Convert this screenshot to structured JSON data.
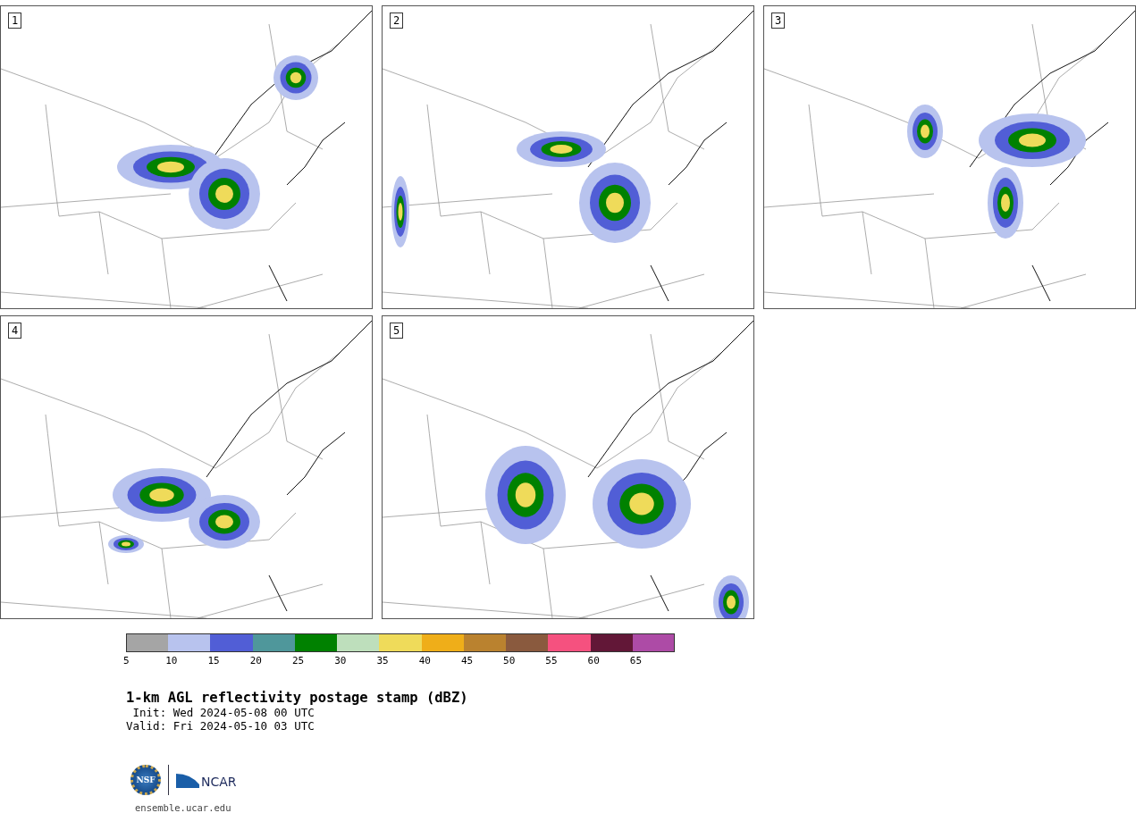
{
  "panels": [
    {
      "label": "1"
    },
    {
      "label": "2"
    },
    {
      "label": "3"
    },
    {
      "label": "4"
    },
    {
      "label": "5"
    }
  ],
  "colorbar": [
    {
      "label": "5",
      "color": "#a5a5a5"
    },
    {
      "label": "10",
      "color": "#b8c3ee"
    },
    {
      "label": "15",
      "color": "#515ed6"
    },
    {
      "label": "20",
      "color": "#4f979b"
    },
    {
      "label": "25",
      "color": "#008100"
    },
    {
      "label": "30",
      "color": "#bedfbc"
    },
    {
      "label": "35",
      "color": "#efdb5a"
    },
    {
      "label": "40",
      "color": "#efae19"
    },
    {
      "label": "45",
      "color": "#ba822f"
    },
    {
      "label": "50",
      "color": "#8a5a3e"
    },
    {
      "label": "55",
      "color": "#f5517f"
    },
    {
      "label": "60",
      "color": "#621737"
    },
    {
      "label": "65",
      "color": "#ad4ba6"
    }
  ],
  "title": "1-km AGL reflectivity postage stamp (dBZ)",
  "init": " Init: Wed 2024-05-08 00 UTC",
  "valid": "Valid: Fri 2024-05-10 03 UTC",
  "logos": {
    "nsf": "NSF",
    "ncar": "NCAR"
  },
  "footer": "ensemble.ucar.edu"
}
